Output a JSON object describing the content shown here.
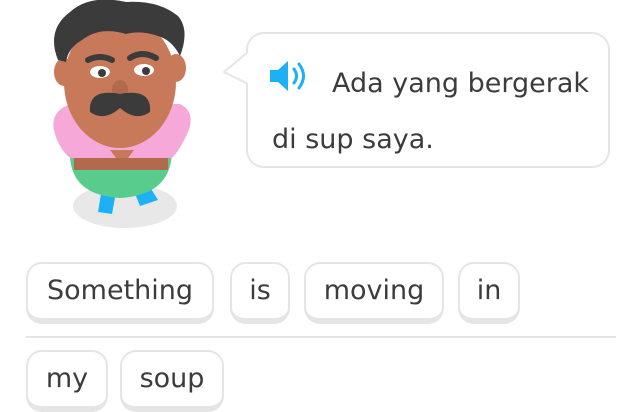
{
  "prompt": {
    "text": "Ada yang bergerak di sup saya.",
    "speaker_icon": "speaker-icon"
  },
  "character": {
    "icon": "character-oscar"
  },
  "word_bank": {
    "tiles": [
      "Something",
      "is",
      "moving",
      "in",
      "my",
      "soup"
    ]
  },
  "colors": {
    "speaker_blue": "#1cb0f6",
    "tile_border": "#e5e5e5",
    "text": "#3c3c3c",
    "shirt_pink": "#f6a8d8",
    "pants_green": "#58cc8c",
    "skin": "#c8795a"
  }
}
